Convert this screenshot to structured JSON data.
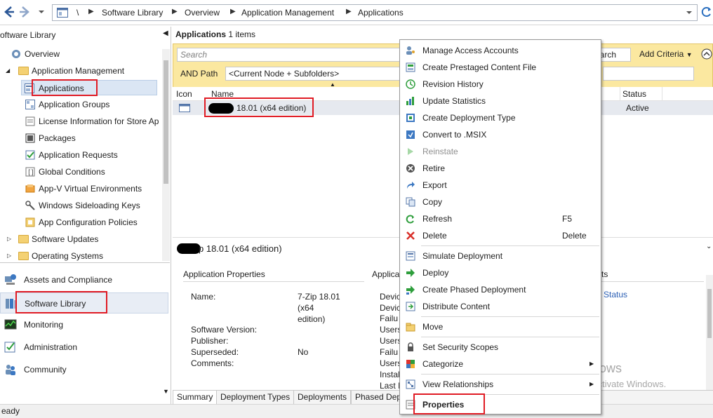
{
  "breadcrumb": {
    "root": "\\",
    "items": [
      "Software Library",
      "Overview",
      "Application Management",
      "Applications"
    ]
  },
  "left_pane": {
    "title": "oftware Library",
    "tree": [
      {
        "label": "Overview",
        "icon": "overview-icon"
      },
      {
        "label": "Application Management",
        "icon": "folder-icon"
      },
      {
        "label": "Applications",
        "icon": "applications-icon"
      },
      {
        "label": "Application Groups",
        "icon": "application-groups-icon"
      },
      {
        "label": "License Information for Store Ap",
        "icon": "license-icon"
      },
      {
        "label": "Packages",
        "icon": "packages-icon"
      },
      {
        "label": "Application Requests",
        "icon": "requests-icon"
      },
      {
        "label": "Global Conditions",
        "icon": "conditions-icon"
      },
      {
        "label": "App-V Virtual Environments",
        "icon": "appv-icon"
      },
      {
        "label": "Windows Sideloading Keys",
        "icon": "key-icon"
      },
      {
        "label": "App Configuration Policies",
        "icon": "policy-icon"
      },
      {
        "label": "Software Updates",
        "icon": "folder-icon"
      },
      {
        "label": "Operating Systems",
        "icon": "folder-icon"
      }
    ],
    "workspaces": [
      {
        "label": "Assets and Compliance",
        "icon": "assets-icon"
      },
      {
        "label": "Software Library",
        "icon": "library-icon"
      },
      {
        "label": "Monitoring",
        "icon": "monitoring-icon"
      },
      {
        "label": "Administration",
        "icon": "administration-icon"
      },
      {
        "label": "Community",
        "icon": "community-icon"
      }
    ]
  },
  "main": {
    "header_title": "Applications",
    "header_count": "1 items",
    "search_placeholder": "Search",
    "search_button": "earch",
    "add_criteria": "Add Criteria",
    "and_path_label": "AND Path",
    "path_value": "<Current Node + Subfolders>",
    "columns": {
      "icon": "Icon",
      "name": "Name",
      "status": "Status"
    },
    "row": {
      "name": "18.01 (x64 edition)",
      "status": "Active"
    },
    "detail_title": "p 18.01 (x64 edition)",
    "detail": {
      "section_props": "Application Properties",
      "section_appl": "Applica",
      "section_ts": "ts",
      "status_link": "Status",
      "labels": [
        "Name:",
        "Software Version:",
        "Publisher:",
        "Superseded:",
        "Comments:"
      ],
      "name_value_lines": [
        "7-Zip 18.01",
        "(x64",
        "edition)"
      ],
      "superseded_value": "No",
      "col2_labels": [
        "Devic",
        "Devic",
        "Failu",
        "Users",
        "Users",
        "Failu",
        "Users",
        "Instal",
        "Last I"
      ]
    },
    "tabs": [
      "Summary",
      "Deployment Types",
      "Deployments",
      "Phased Dep"
    ]
  },
  "context_menu": {
    "items": [
      {
        "label": "Manage Access Accounts",
        "icon": "access-accounts-icon"
      },
      {
        "label": "Create Prestaged Content File",
        "icon": "prestaged-content-icon"
      },
      {
        "label": "Revision History",
        "icon": "revision-history-icon"
      },
      {
        "label": "Update Statistics",
        "icon": "statistics-icon"
      },
      {
        "label": "Create Deployment Type",
        "icon": "deployment-type-icon"
      },
      {
        "label": "Convert to .MSIX",
        "icon": "msix-icon"
      },
      {
        "label": "Reinstate",
        "icon": "reinstate-icon",
        "disabled": true
      },
      {
        "label": "Retire",
        "icon": "retire-icon"
      },
      {
        "label": "Export",
        "icon": "export-icon"
      },
      {
        "label": "Copy",
        "icon": "copy-icon"
      },
      {
        "label": "Refresh",
        "icon": "refresh-icon",
        "shortcut": "F5"
      },
      {
        "label": "Delete",
        "icon": "delete-icon",
        "shortcut": "Delete"
      },
      {
        "label": "Simulate Deployment",
        "icon": "simulate-icon"
      },
      {
        "label": "Deploy",
        "icon": "deploy-icon"
      },
      {
        "label": "Create Phased Deployment",
        "icon": "phased-deployment-icon"
      },
      {
        "label": "Distribute Content",
        "icon": "distribute-icon"
      },
      {
        "label": "Move",
        "icon": "move-icon"
      },
      {
        "label": "Set Security Scopes",
        "icon": "security-scopes-icon"
      },
      {
        "label": "Categorize",
        "icon": "categorize-icon"
      },
      {
        "label": "View Relationships",
        "icon": "relationships-icon"
      },
      {
        "label": "Properties",
        "icon": "properties-icon"
      }
    ]
  },
  "watermark": {
    "line1": "Activate Windows",
    "line2": "Go to Settings to activate Windows."
  },
  "status_bar": {
    "text": "eady"
  },
  "colors": {
    "criteria_bar": "#fbe8a0",
    "highlight": "#e01b24",
    "selected_row": "#e6e9ef"
  }
}
